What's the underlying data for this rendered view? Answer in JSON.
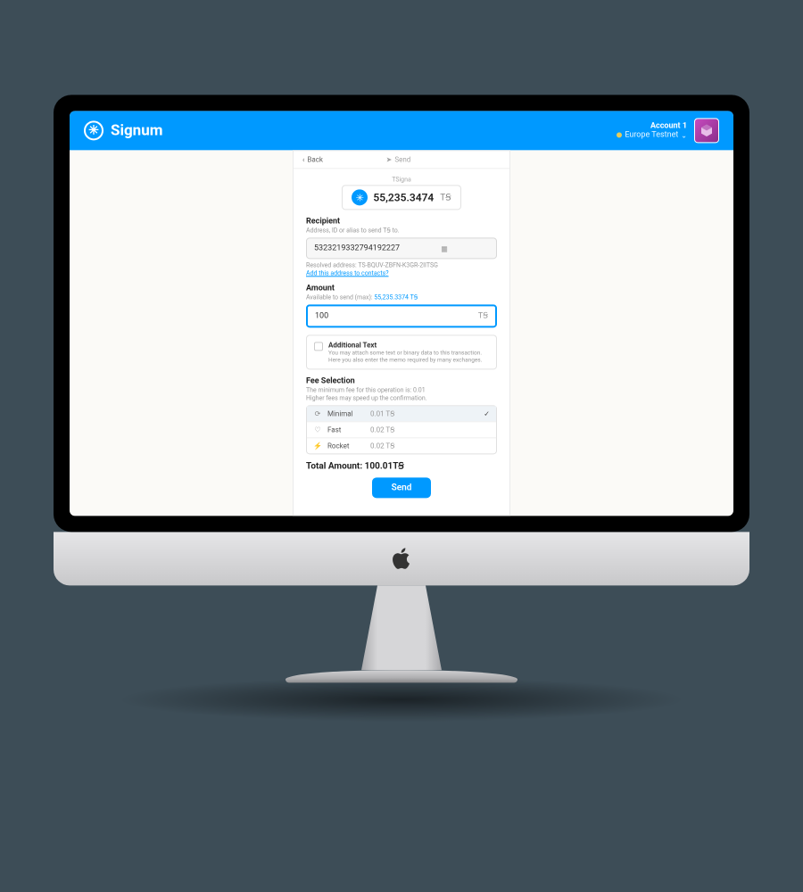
{
  "header": {
    "brand": "Signum",
    "account_name": "Account 1",
    "network": "Europe Testnet"
  },
  "nav": {
    "back": "Back",
    "send_tab": "Send"
  },
  "balance": {
    "token_label": "TSigna",
    "value": "55,235.3474",
    "symbol": "TꞨ"
  },
  "recipient": {
    "label": "Recipient",
    "hint": "Address, ID or alias to send TꞨ to.",
    "value": "5323219332794192227",
    "resolved_prefix": "Resolved address: ",
    "resolved_addr": "TS-BQUV-ZBFN-K3GR-2IITSG",
    "add_link": "Add this address to contacts?"
  },
  "amount": {
    "label": "Amount",
    "hint_prefix": "Available to send (max): ",
    "hint_max": "55,235.3374 TꞨ",
    "value": "100",
    "suffix": "TꞨ"
  },
  "additional": {
    "title": "Additional Text",
    "desc": "You may attach some text or binary data to this transaction. Here you also enter the memo required by many exchanges."
  },
  "fee": {
    "label": "Fee Selection",
    "hint1": "The minimum fee for this operation is: 0.01",
    "hint2": "Higher fees may speed up the confirmation.",
    "options": [
      {
        "icon": "⟳",
        "name": "Minimal",
        "value": "0.01 TꞨ",
        "selected": true
      },
      {
        "icon": "♡",
        "name": "Fast",
        "value": "0.02 TꞨ",
        "selected": false
      },
      {
        "icon": "⚡",
        "name": "Rocket",
        "value": "0.02 TꞨ",
        "selected": false
      }
    ]
  },
  "total": {
    "label": "Total Amount: ",
    "value": "100.01TꞨ"
  },
  "actions": {
    "send": "Send"
  }
}
